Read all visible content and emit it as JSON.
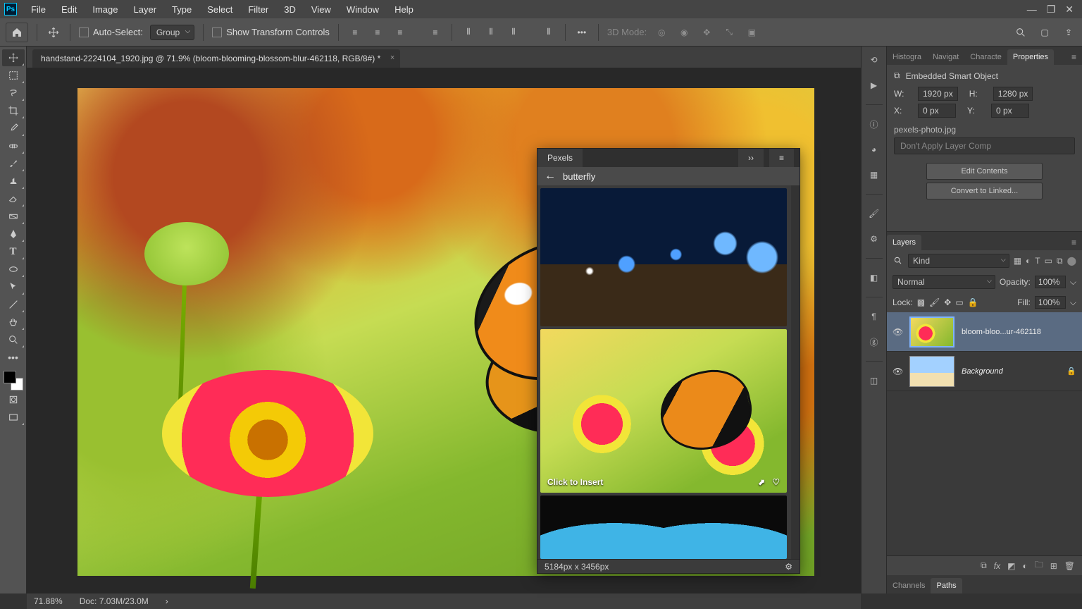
{
  "menubar": [
    "File",
    "Edit",
    "Image",
    "Layer",
    "Type",
    "Select",
    "Filter",
    "3D",
    "View",
    "Window",
    "Help"
  ],
  "options": {
    "auto_select": "Auto-Select:",
    "group": "Group",
    "show_transform": "Show Transform Controls",
    "mode3d": "3D Mode:"
  },
  "doc_tab": "handstand-2224104_1920.jpg @ 71.9% (bloom-blooming-blossom-blur-462118, RGB/8#) *",
  "status": {
    "zoom": "71.88%",
    "doc": "Doc: 7.03M/23.0M"
  },
  "right_tabs": [
    "Histogra",
    "Navigat",
    "Characte",
    "Properties"
  ],
  "properties": {
    "type": "Embedded Smart Object",
    "W_label": "W:",
    "W": "1920 px",
    "H_label": "H:",
    "H": "1280 px",
    "X_label": "X:",
    "X": "0 px",
    "Y_label": "Y:",
    "Y": "0 px",
    "file": "pexels-photo.jpg",
    "comp": "Don't Apply Layer Comp",
    "edit_btn": "Edit Contents",
    "convert_btn": "Convert to Linked..."
  },
  "layers_panel": {
    "title": "Layers",
    "kind": "Kind",
    "blend": "Normal",
    "opacity_l": "Opacity:",
    "opacity": "100%",
    "lock_l": "Lock:",
    "fill_l": "Fill:",
    "fill": "100%",
    "layers": [
      {
        "name": "bloom-bloo...ur-462118",
        "sel": true
      },
      {
        "name": "Background",
        "sel": false,
        "locked": true,
        "italic": true
      }
    ]
  },
  "bottom_tabs": [
    "Channels",
    "Paths"
  ],
  "pexels": {
    "title": "Pexels",
    "query": "butterfly",
    "insert": "Click to Insert",
    "dims": "5184px x 3456px"
  }
}
